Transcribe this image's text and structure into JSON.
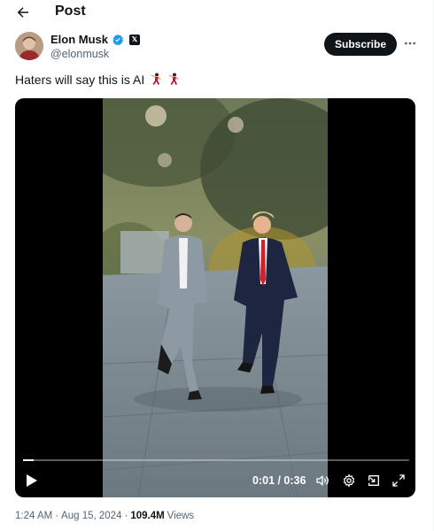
{
  "header": {
    "title": "Post",
    "back_icon": "arrow-left-icon"
  },
  "author": {
    "name": "Elon Musk",
    "handle": "@elonmusk",
    "verified_color": "#1d9bf0",
    "badge_icon": "x-logo-icon"
  },
  "actions": {
    "subscribe_label": "Subscribe",
    "more_icon": "more-horizontal-icon"
  },
  "tweet": {
    "text": "Haters will say this is AI",
    "emojis": [
      "man-dancing-emoji",
      "man-dancing-emoji"
    ]
  },
  "video": {
    "time_display": "0:01 / 0:36",
    "progress": 0.028,
    "controls": [
      "play-icon",
      "volume-icon",
      "settings-icon",
      "picture-in-picture-icon",
      "fullscreen-icon"
    ]
  },
  "meta": {
    "time": "1:24 AM",
    "separator": "·",
    "date": "Aug 15, 2024",
    "views_count": "109.4M",
    "views_label": "Views"
  },
  "colors": {
    "accent": "#1d9bf0",
    "text": "#0f1419",
    "muted": "#536471"
  }
}
